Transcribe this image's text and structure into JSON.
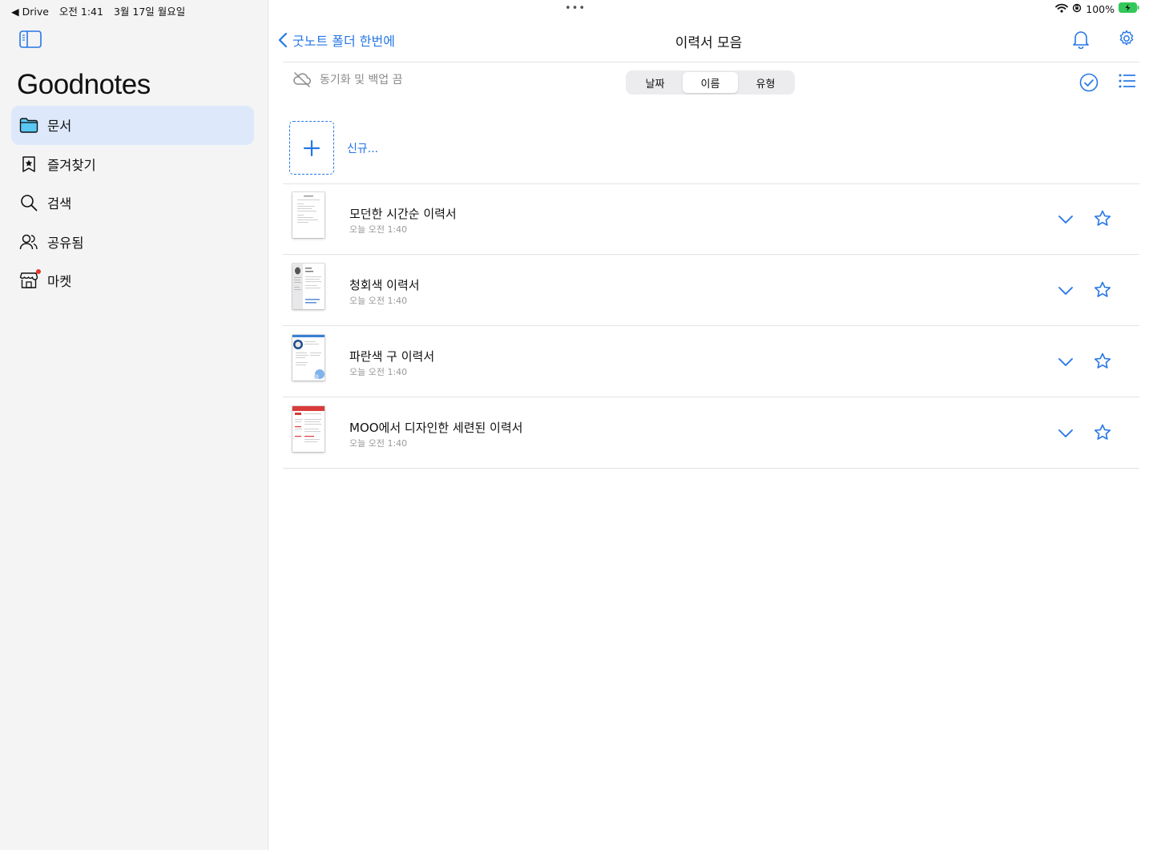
{
  "status_bar": {
    "back_app": "◀ Drive",
    "time": "오전 1:41",
    "date": "3월 17일 월요일",
    "battery": "100%"
  },
  "sidebar": {
    "brand": "Goodnotes",
    "items": [
      {
        "label": "문서",
        "icon": "folder-icon",
        "active": true
      },
      {
        "label": "즐겨찾기",
        "icon": "bookmark-star-icon",
        "active": false
      },
      {
        "label": "검색",
        "icon": "search-icon",
        "active": false
      },
      {
        "label": "공유됨",
        "icon": "people-icon",
        "active": false
      },
      {
        "label": "마켓",
        "icon": "store-icon",
        "active": false
      }
    ]
  },
  "header": {
    "back_label": "굿노트 폴더 한번에",
    "title": "이력서 모음"
  },
  "toolbar": {
    "sync_label": "동기화 및 백업 끔",
    "sort_options": [
      "날짜",
      "이름",
      "유형"
    ],
    "sort_selected": "이름"
  },
  "new_item": {
    "label": "신규..."
  },
  "documents": [
    {
      "name": "모던한 시간순 이력서",
      "date": "오늘 오전 1:40"
    },
    {
      "name": "청회색 이력서",
      "date": "오늘 오전 1:40"
    },
    {
      "name": "파란색 구 이력서",
      "date": "오늘 오전 1:40"
    },
    {
      "name": "MOO에서 디자인한 세련된 이력서",
      "date": "오늘 오전 1:40"
    }
  ],
  "colors": {
    "accent": "#2577e6",
    "sidebar_bg": "#f4f4f5",
    "active_bg": "#dde9fb",
    "notification_dot": "#e5382d"
  }
}
